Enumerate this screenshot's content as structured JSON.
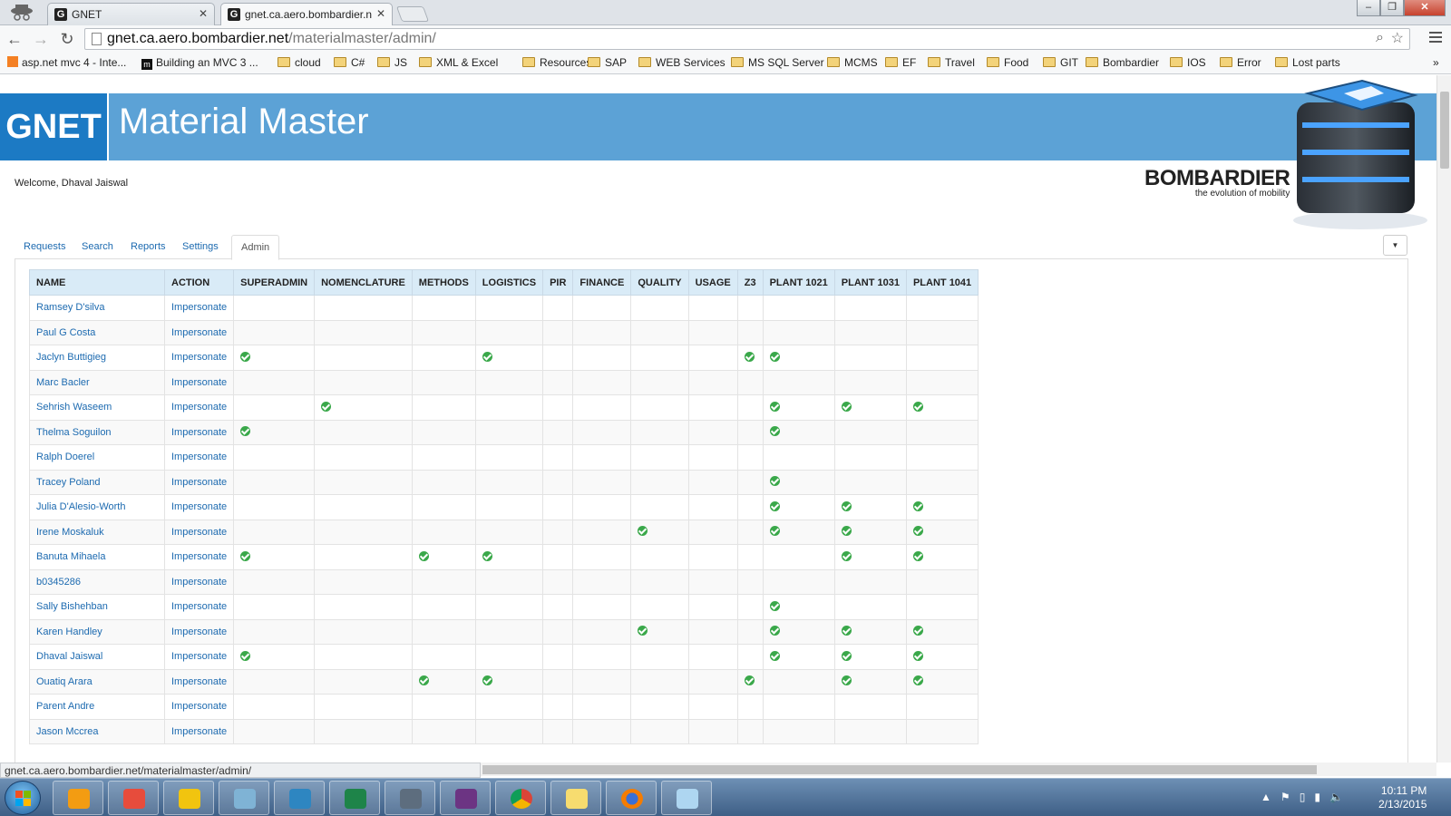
{
  "browser": {
    "tabs": [
      {
        "label": "GNET"
      },
      {
        "label": "gnet.ca.aero.bombardier.n"
      }
    ],
    "url_host": "gnet.ca.aero.bombardier.net",
    "url_path": "/materialmaster/admin/",
    "bookmarks": [
      {
        "label": "asp.net mvc 4 - Inte...",
        "icon": "stackoverflow-icon"
      },
      {
        "label": "Building an MVC 3 ...",
        "icon": "m-icon"
      },
      {
        "label": "cloud",
        "icon": "folder-icon"
      },
      {
        "label": "C#",
        "icon": "folder-icon"
      },
      {
        "label": "JS",
        "icon": "folder-icon"
      },
      {
        "label": "XML & Excel",
        "icon": "folder-icon"
      },
      {
        "label": "Resources",
        "icon": "folder-icon"
      },
      {
        "label": "SAP",
        "icon": "folder-icon"
      },
      {
        "label": "WEB Services",
        "icon": "folder-icon"
      },
      {
        "label": "MS SQL Server",
        "icon": "folder-icon"
      },
      {
        "label": "MCMS",
        "icon": "folder-icon"
      },
      {
        "label": "EF",
        "icon": "folder-icon"
      },
      {
        "label": "Travel",
        "icon": "folder-icon"
      },
      {
        "label": "Food",
        "icon": "folder-icon"
      },
      {
        "label": "GIT",
        "icon": "folder-icon"
      },
      {
        "label": "Bombardier",
        "icon": "folder-icon"
      },
      {
        "label": "IOS",
        "icon": "folder-icon"
      },
      {
        "label": "Error",
        "icon": "folder-icon"
      },
      {
        "label": "Lost parts",
        "icon": "folder-icon"
      }
    ],
    "status_url": "gnet.ca.aero.bombardier.net/materialmaster/admin/"
  },
  "header": {
    "logo_text": "GNET",
    "title": "Material Master",
    "welcome": "Welcome, Dhaval Jaiswal",
    "brand_name": "BOMBARDIER",
    "brand_tagline": "the evolution of mobility"
  },
  "nav": {
    "tabs": [
      "Requests",
      "Search",
      "Reports",
      "Settings",
      "Admin"
    ],
    "active": "Admin"
  },
  "table": {
    "columns": [
      "NAME",
      "ACTION",
      "SUPERADMIN",
      "NOMENCLATURE",
      "METHODS",
      "LOGISTICS",
      "PIR",
      "FINANCE",
      "QUALITY",
      "USAGE",
      "Z3",
      "PLANT 1021",
      "PLANT 1031",
      "PLANT 1041"
    ],
    "action_label": "Impersonate",
    "rows": [
      {
        "name": "Ramsey D'silva",
        "checks": [
          0,
          0,
          0,
          0,
          0,
          0,
          0,
          0,
          0,
          0,
          0,
          0
        ]
      },
      {
        "name": "Paul G Costa",
        "checks": [
          0,
          0,
          0,
          0,
          0,
          0,
          0,
          0,
          0,
          0,
          0,
          0
        ]
      },
      {
        "name": "Jaclyn Buttigieg",
        "checks": [
          1,
          0,
          0,
          1,
          0,
          0,
          0,
          0,
          1,
          1,
          0,
          0
        ]
      },
      {
        "name": "Marc Bacler",
        "checks": [
          0,
          0,
          0,
          0,
          0,
          0,
          0,
          0,
          0,
          0,
          0,
          0
        ]
      },
      {
        "name": "Sehrish Waseem",
        "checks": [
          0,
          1,
          0,
          0,
          0,
          0,
          0,
          0,
          0,
          1,
          1,
          1
        ]
      },
      {
        "name": "Thelma Soguilon",
        "checks": [
          1,
          0,
          0,
          0,
          0,
          0,
          0,
          0,
          0,
          1,
          0,
          0
        ]
      },
      {
        "name": "Ralph Doerel",
        "checks": [
          0,
          0,
          0,
          0,
          0,
          0,
          0,
          0,
          0,
          0,
          0,
          0
        ]
      },
      {
        "name": "Tracey Poland",
        "checks": [
          0,
          0,
          0,
          0,
          0,
          0,
          0,
          0,
          0,
          1,
          0,
          0
        ]
      },
      {
        "name": "Julia D'Alesio-Worth",
        "checks": [
          0,
          0,
          0,
          0,
          0,
          0,
          0,
          0,
          0,
          1,
          1,
          1
        ]
      },
      {
        "name": "Irene Moskaluk",
        "checks": [
          0,
          0,
          0,
          0,
          0,
          0,
          1,
          0,
          0,
          1,
          1,
          1
        ]
      },
      {
        "name": "Banuta Mihaela",
        "checks": [
          1,
          0,
          1,
          1,
          0,
          0,
          0,
          0,
          0,
          0,
          1,
          1
        ]
      },
      {
        "name": "b0345286",
        "checks": [
          0,
          0,
          0,
          0,
          0,
          0,
          0,
          0,
          0,
          0,
          0,
          0
        ]
      },
      {
        "name": "Sally Bishehban",
        "checks": [
          0,
          0,
          0,
          0,
          0,
          0,
          0,
          0,
          0,
          1,
          0,
          0
        ]
      },
      {
        "name": "Karen Handley",
        "checks": [
          0,
          0,
          0,
          0,
          0,
          0,
          1,
          0,
          0,
          1,
          1,
          1
        ]
      },
      {
        "name": "Dhaval Jaiswal",
        "checks": [
          1,
          0,
          0,
          0,
          0,
          0,
          0,
          0,
          0,
          1,
          1,
          1
        ]
      },
      {
        "name": "Ouatiq Arara",
        "checks": [
          0,
          0,
          1,
          1,
          0,
          0,
          0,
          0,
          1,
          0,
          1,
          1
        ]
      },
      {
        "name": "Parent Andre",
        "checks": [
          0,
          0,
          0,
          0,
          0,
          0,
          0,
          0,
          0,
          0,
          0,
          0
        ]
      },
      {
        "name": "Jason Mccrea",
        "checks": [
          0,
          0,
          0,
          0,
          0,
          0,
          0,
          0,
          0,
          0,
          0,
          0
        ]
      }
    ]
  },
  "taskbar": {
    "apps": [
      "media-player-icon",
      "git-icon",
      "outlook-icon",
      "notepad-icon",
      "remote-desktop-icon",
      "excel-icon",
      "tools-icon",
      "vm-icon",
      "chrome-icon",
      "file-explorer-icon",
      "firefox-icon",
      "paint-icon"
    ],
    "time": "10:11 PM",
    "date": "2/13/2015"
  },
  "colors": {
    "banner": "#5ca2d6",
    "logo_bg": "#1c7ac4",
    "link": "#1c6ab0",
    "check": "#3aa84a",
    "table_header": "#d9ebf7"
  }
}
